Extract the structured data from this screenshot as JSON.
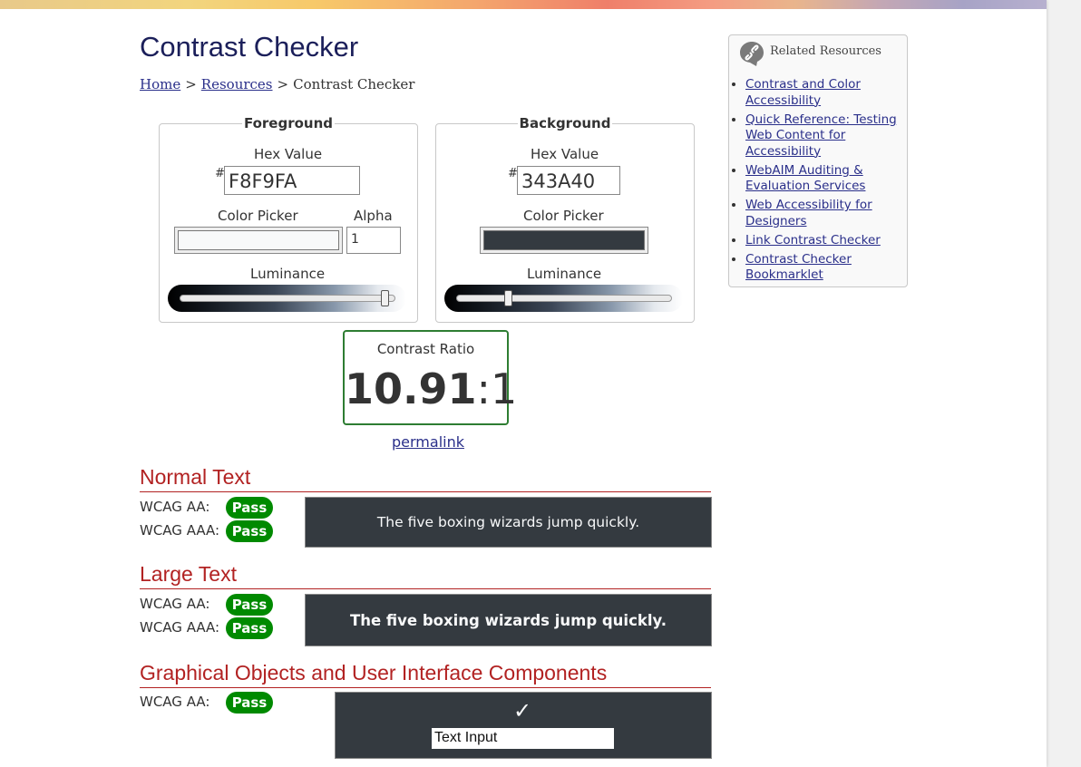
{
  "page": {
    "title": "Contrast Checker",
    "breadcrumb": {
      "home": "Home",
      "sep1": ">",
      "resources": "Resources",
      "sep2": ">",
      "current": "Contrast Checker"
    }
  },
  "foreground": {
    "legend": "Foreground",
    "hex_label": "Hex Value",
    "hash": "#",
    "hex_value": "F8F9FA",
    "picker_label": "Color Picker",
    "alpha_label": "Alpha",
    "alpha_value": "1",
    "luminance_label": "Luminance",
    "color": "#F8F9FA",
    "luminance_level": 0.95
  },
  "background": {
    "legend": "Background",
    "hex_label": "Hex Value",
    "hash": "#",
    "hex_value": "343A40",
    "picker_label": "Color Picker",
    "luminance_label": "Luminance",
    "color": "#343A40",
    "luminance_level": 0.24
  },
  "ratio": {
    "label": "Contrast Ratio",
    "value": "10.91",
    "suffix": ":1",
    "permalink": "permalink"
  },
  "normal_text": {
    "heading": "Normal Text",
    "aa_label": "WCAG AA:",
    "aa_result": "Pass",
    "aaa_label": "WCAG AAA:",
    "aaa_result": "Pass",
    "sample": "The five boxing wizards jump quickly."
  },
  "large_text": {
    "heading": "Large Text",
    "aa_label": "WCAG AA:",
    "aa_result": "Pass",
    "aaa_label": "WCAG AAA:",
    "aaa_result": "Pass",
    "sample": "The five boxing wizards jump quickly."
  },
  "graphical": {
    "heading": "Graphical Objects and User Interface Components",
    "aa_label": "WCAG AA:",
    "aa_result": "Pass",
    "check": "✓",
    "input_text": "Text Input"
  },
  "related": {
    "title": "Related Resources",
    "links": [
      {
        "label": "Contrast and Color Accessibility"
      },
      {
        "label": "Quick Reference: Testing Web Content for Accessibility"
      },
      {
        "label": "WebAIM Auditing & Evaluation Services"
      },
      {
        "label": "Web Accessibility for Designers"
      },
      {
        "label": "Link Contrast Checker"
      },
      {
        "label": "Contrast Checker Bookmarklet"
      }
    ]
  },
  "colors": {
    "pass_green": "#008A00",
    "heading_red": "#B22222",
    "link_blue": "#2A2F8A",
    "ratio_border": "#2E7D32"
  }
}
